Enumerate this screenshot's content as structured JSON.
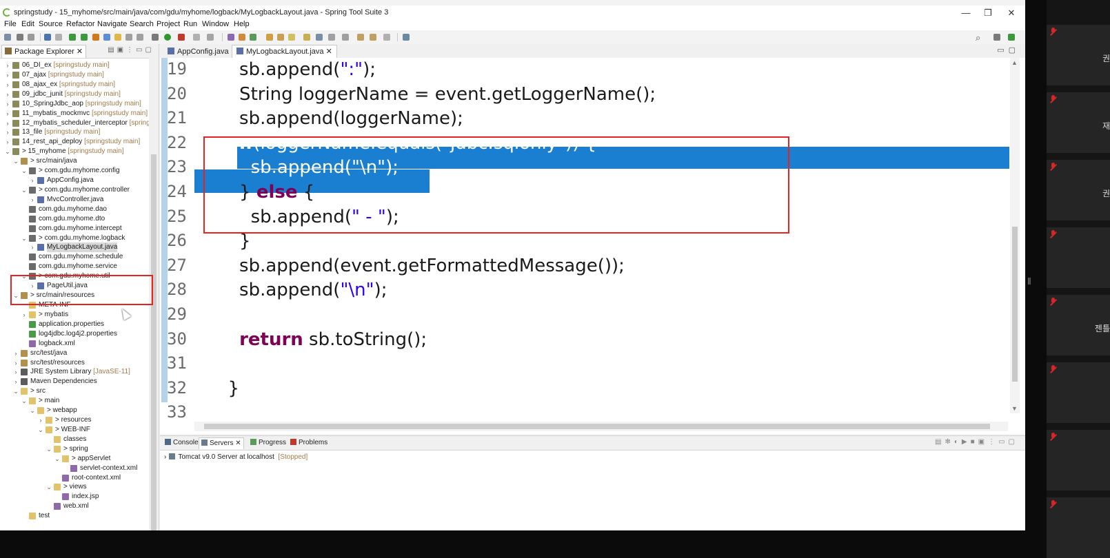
{
  "window": {
    "title": "springstudy - 15_myhome/src/main/java/com/gdu/myhome/logback/MyLogbackLayout.java - Spring Tool Suite 3",
    "controls": [
      "—",
      "❐",
      "✕"
    ]
  },
  "menu": [
    "File",
    "Edit",
    "Source",
    "Refactor",
    "Navigate",
    "Search",
    "Project",
    "Run",
    "Window",
    "Help"
  ],
  "package_explorer": {
    "tab_label": "Package Explorer",
    "rows": [
      {
        "indent": 0,
        "twisty": "›",
        "icon": "proj",
        "label": "06_DI_ex",
        "decoration": "[springstudy main]"
      },
      {
        "indent": 0,
        "twisty": "›",
        "icon": "proj",
        "label": "07_ajax",
        "decoration": "[springstudy main]"
      },
      {
        "indent": 0,
        "twisty": "›",
        "icon": "proj",
        "label": "08_ajax_ex",
        "decoration": "[springstudy main]"
      },
      {
        "indent": 0,
        "twisty": "›",
        "icon": "proj",
        "label": "09_jdbc_junit",
        "decoration": "[springstudy main]"
      },
      {
        "indent": 0,
        "twisty": "›",
        "icon": "proj",
        "label": "10_SpringJdbc_aop",
        "decoration": "[springstudy main]"
      },
      {
        "indent": 0,
        "twisty": "›",
        "icon": "proj",
        "label": "11_mybatis_mockmvc",
        "decoration": "[springstudy main]"
      },
      {
        "indent": 0,
        "twisty": "›",
        "icon": "proj",
        "label": "12_mybatis_scheduler_interceptor",
        "decoration": "[springstu"
      },
      {
        "indent": 0,
        "twisty": "›",
        "icon": "proj",
        "label": "13_file",
        "decoration": "[springstudy main]"
      },
      {
        "indent": 0,
        "twisty": "›",
        "icon": "proj",
        "label": "14_rest_api_deploy",
        "decoration": "[springstudy main]"
      },
      {
        "indent": 0,
        "twisty": "⌄",
        "icon": "proj",
        "label": "> 15_myhome",
        "decoration": "[springstudy main]"
      },
      {
        "indent": 1,
        "twisty": "⌄",
        "icon": "src",
        "label": "> src/main/java",
        "decoration": ""
      },
      {
        "indent": 2,
        "twisty": "⌄",
        "icon": "pkg",
        "label": "> com.gdu.myhome.config",
        "decoration": ""
      },
      {
        "indent": 3,
        "twisty": "›",
        "icon": "java",
        "label": "AppConfig.java",
        "decoration": ""
      },
      {
        "indent": 2,
        "twisty": "⌄",
        "icon": "pkg",
        "label": "> com.gdu.myhome.controller",
        "decoration": ""
      },
      {
        "indent": 3,
        "twisty": "›",
        "icon": "java",
        "label": "MvcController.java",
        "decoration": ""
      },
      {
        "indent": 2,
        "twisty": "",
        "icon": "pkg",
        "label": "com.gdu.myhome.dao",
        "decoration": ""
      },
      {
        "indent": 2,
        "twisty": "",
        "icon": "pkg",
        "label": "com.gdu.myhome.dto",
        "decoration": ""
      },
      {
        "indent": 2,
        "twisty": "",
        "icon": "pkg",
        "label": "com.gdu.myhome.intercept",
        "decoration": ""
      },
      {
        "indent": 2,
        "twisty": "⌄",
        "icon": "pkg",
        "label": "> com.gdu.myhome.logback",
        "decoration": ""
      },
      {
        "indent": 3,
        "twisty": "›",
        "icon": "java",
        "label": "MyLogbackLayout.java",
        "decoration": "",
        "selected": true
      },
      {
        "indent": 2,
        "twisty": "",
        "icon": "pkg",
        "label": "com.gdu.myhome.schedule",
        "decoration": ""
      },
      {
        "indent": 2,
        "twisty": "",
        "icon": "pkg",
        "label": "com.gdu.myhome.service",
        "decoration": ""
      },
      {
        "indent": 2,
        "twisty": "⌄",
        "icon": "pkg",
        "label": "> com.gdu.myhome.util",
        "decoration": ""
      },
      {
        "indent": 3,
        "twisty": "›",
        "icon": "java",
        "label": "PageUtil.java",
        "decoration": ""
      },
      {
        "indent": 1,
        "twisty": "⌄",
        "icon": "src",
        "label": "> src/main/resources",
        "decoration": ""
      },
      {
        "indent": 2,
        "twisty": "",
        "icon": "folder",
        "label": "META-INF",
        "decoration": ""
      },
      {
        "indent": 2,
        "twisty": "›",
        "icon": "folder",
        "label": "> mybatis",
        "decoration": ""
      },
      {
        "indent": 2,
        "twisty": "",
        "icon": "prop",
        "label": "application.properties",
        "decoration": ""
      },
      {
        "indent": 2,
        "twisty": "",
        "icon": "prop",
        "label": "log4jdbc.log4j2.properties",
        "decoration": ""
      },
      {
        "indent": 2,
        "twisty": "",
        "icon": "xml",
        "label": "logback.xml",
        "decoration": ""
      },
      {
        "indent": 1,
        "twisty": "›",
        "icon": "src",
        "label": "src/test/java",
        "decoration": ""
      },
      {
        "indent": 1,
        "twisty": "›",
        "icon": "src",
        "label": "src/test/resources",
        "decoration": ""
      },
      {
        "indent": 1,
        "twisty": "›",
        "icon": "lib",
        "label": "JRE System Library",
        "decoration": "[JavaSE-11]"
      },
      {
        "indent": 1,
        "twisty": "›",
        "icon": "lib",
        "label": "Maven Dependencies",
        "decoration": ""
      },
      {
        "indent": 1,
        "twisty": "⌄",
        "icon": "folder",
        "label": "> src",
        "decoration": ""
      },
      {
        "indent": 2,
        "twisty": "⌄",
        "icon": "folder",
        "label": "> main",
        "decoration": ""
      },
      {
        "indent": 3,
        "twisty": "⌄",
        "icon": "folder",
        "label": "> webapp",
        "decoration": ""
      },
      {
        "indent": 4,
        "twisty": "›",
        "icon": "folder",
        "label": "> resources",
        "decoration": ""
      },
      {
        "indent": 4,
        "twisty": "⌄",
        "icon": "folder",
        "label": "> WEB-INF",
        "decoration": ""
      },
      {
        "indent": 5,
        "twisty": "",
        "icon": "folder",
        "label": "classes",
        "decoration": ""
      },
      {
        "indent": 5,
        "twisty": "⌄",
        "icon": "folder",
        "label": "> spring",
        "decoration": ""
      },
      {
        "indent": 6,
        "twisty": "⌄",
        "icon": "folder",
        "label": "> appServlet",
        "decoration": ""
      },
      {
        "indent": 7,
        "twisty": "",
        "icon": "xml",
        "label": "servlet-context.xml",
        "decoration": ""
      },
      {
        "indent": 6,
        "twisty": "",
        "icon": "xml",
        "label": "root-context.xml",
        "decoration": ""
      },
      {
        "indent": 5,
        "twisty": "⌄",
        "icon": "folder",
        "label": "> views",
        "decoration": ""
      },
      {
        "indent": 6,
        "twisty": "",
        "icon": "xml",
        "label": "index.jsp",
        "decoration": ""
      },
      {
        "indent": 5,
        "twisty": "",
        "icon": "xml",
        "label": "web.xml",
        "decoration": ""
      },
      {
        "indent": 2,
        "twisty": "",
        "icon": "folder",
        "label": "test",
        "decoration": ""
      }
    ]
  },
  "editor": {
    "tabs": [
      {
        "label": "AppConfig.java",
        "active": false
      },
      {
        "label": "MyLogbackLayout.java",
        "active": true
      }
    ],
    "lines": [
      {
        "num": "19",
        "html": "    sb.append(<span class=\"str\">\":\"</span>);"
      },
      {
        "num": "20",
        "html": "    String loggerName = event.getLoggerName();"
      },
      {
        "num": "21",
        "html": "    sb.append(loggerName);"
      },
      {
        "num": "22",
        "html": "    <span class=\"kw\">if</span>(loggerName.equals(<span class=\"str\">\"jdbc.sqlonly\"</span>)) {",
        "selected": true
      },
      {
        "num": "23",
        "html": "      sb.append(<span class=\"str\">\"\\n\"</span>);",
        "selected": true
      },
      {
        "num": "24",
        "html": "    } <span class=\"kw\">else</span> {"
      },
      {
        "num": "25",
        "html": "      sb.append(<span class=\"str\">\" - \"</span>);"
      },
      {
        "num": "26",
        "html": "    }"
      },
      {
        "num": "27",
        "html": "    sb.append(event.getFormattedMessage());"
      },
      {
        "num": "28",
        "html": "    sb.append(<span class=\"str\">\"\\n\"</span>);"
      },
      {
        "num": "29",
        "html": ""
      },
      {
        "num": "30",
        "html": "    <span class=\"kw\">return</span> sb.toString();"
      },
      {
        "num": "31",
        "html": ""
      },
      {
        "num": "32",
        "html": "  }"
      },
      {
        "num": "33",
        "html": ""
      }
    ]
  },
  "console": {
    "tabs": [
      "Console",
      "Servers",
      "Progress",
      "Problems"
    ],
    "server_name": "Tomcat v9.0 Server at localhost",
    "server_status": "[Stopped]"
  },
  "participants": [
    {
      "name": "권"
    },
    {
      "name": "재"
    },
    {
      "name": "권"
    },
    {
      "name": ""
    },
    {
      "name": "젠틀"
    },
    {
      "name": ""
    },
    {
      "name": ""
    },
    {
      "name": ""
    }
  ],
  "colors": {
    "selection": "#1a7ed1",
    "highlight_box": "#e8231f",
    "keyword": "#7f0055",
    "string": "#2a00ff"
  }
}
